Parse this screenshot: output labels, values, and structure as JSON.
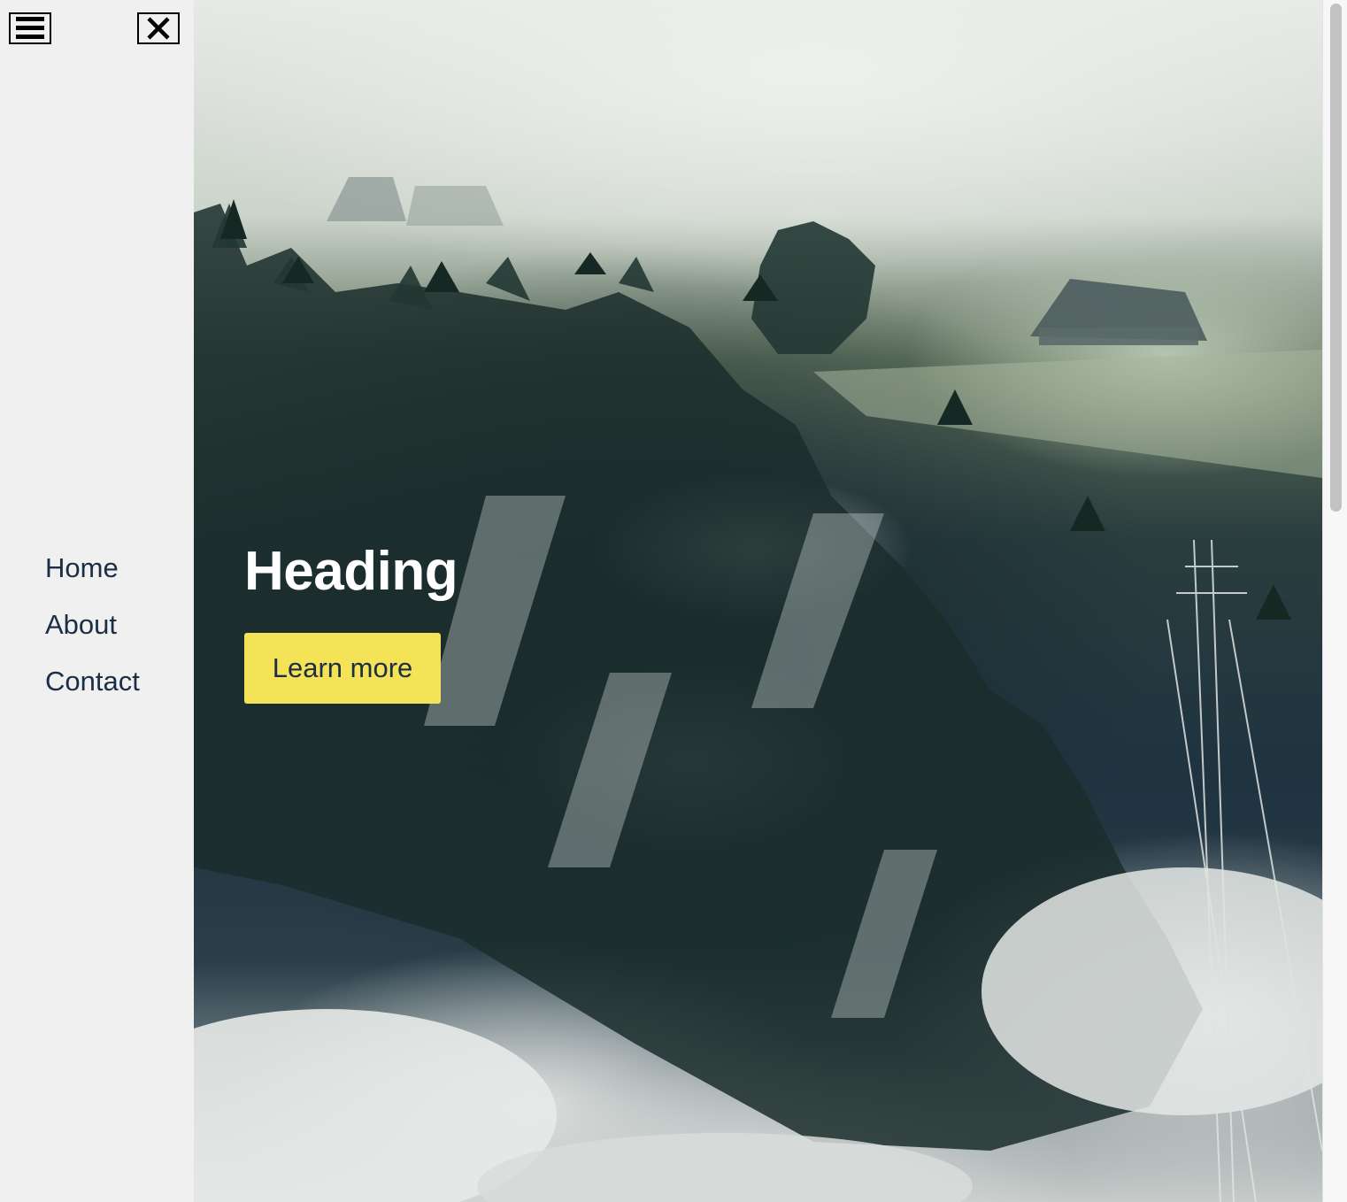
{
  "sidebar": {
    "menu_icon": "hamburger-icon",
    "close_icon": "close-icon",
    "nav_items": [
      {
        "label": "Home"
      },
      {
        "label": "About"
      },
      {
        "label": "Contact"
      }
    ]
  },
  "hero": {
    "title": "Heading",
    "button_label": "Learn more",
    "background": "misty forest landscape photo"
  },
  "colors": {
    "sidebar_bg": "#f0f0f0",
    "nav_text": "#1c2e45",
    "button_bg": "#f4e356",
    "heading_text": "#ffffff"
  }
}
